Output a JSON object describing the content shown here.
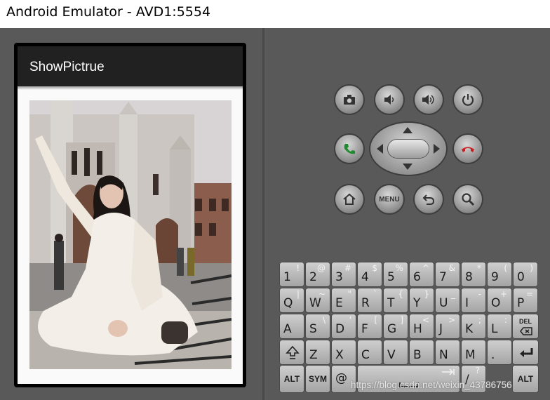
{
  "window": {
    "title": "Android Emulator - AVD1:5554"
  },
  "app": {
    "title": "ShowPictrue"
  },
  "controls": {
    "camera": "camera-icon",
    "volume_down": "volume-down-icon",
    "volume_up": "volume-up-icon",
    "power": "power-icon",
    "call": "call-icon",
    "end_call": "end-call-icon",
    "home": "home-icon",
    "menu_label": "MENU",
    "back": "back-icon",
    "search": "search-icon"
  },
  "keyboard": {
    "row1": [
      {
        "m": "1",
        "s": "!"
      },
      {
        "m": "2",
        "s": "@"
      },
      {
        "m": "3",
        "s": "#"
      },
      {
        "m": "4",
        "s": "$"
      },
      {
        "m": "5",
        "s": "%"
      },
      {
        "m": "6",
        "s": "^"
      },
      {
        "m": "7",
        "s": "&"
      },
      {
        "m": "8",
        "s": "*"
      },
      {
        "m": "9",
        "s": "("
      },
      {
        "m": "0",
        "s": ")"
      }
    ],
    "row2": [
      {
        "m": "Q",
        "s": "|"
      },
      {
        "m": "W",
        "s": "~"
      },
      {
        "m": "E",
        "s": "\""
      },
      {
        "m": "R",
        "s": "`"
      },
      {
        "m": "T",
        "s": "{"
      },
      {
        "m": "Y",
        "s": "}"
      },
      {
        "m": "U",
        "s": "_"
      },
      {
        "m": "I",
        "s": "-"
      },
      {
        "m": "O",
        "s": "+"
      },
      {
        "m": "P",
        "s": "="
      }
    ],
    "row3": [
      {
        "m": "A",
        "s": ""
      },
      {
        "m": "S",
        "s": "\\"
      },
      {
        "m": "D",
        "s": "'"
      },
      {
        "m": "F",
        "s": "["
      },
      {
        "m": "G",
        "s": "]"
      },
      {
        "m": "H",
        "s": "<"
      },
      {
        "m": "J",
        "s": ">"
      },
      {
        "m": "K",
        "s": ";"
      },
      {
        "m": "L",
        "s": ":"
      }
    ],
    "del_label": "DEL",
    "row4": [
      {
        "m": "Z",
        "s": ""
      },
      {
        "m": "X",
        "s": ""
      },
      {
        "m": "C",
        "s": ""
      },
      {
        "m": "V",
        "s": ""
      },
      {
        "m": "B",
        "s": ""
      },
      {
        "m": "N",
        "s": ""
      },
      {
        "m": "M",
        "s": ""
      },
      {
        "m": ".",
        "s": ""
      }
    ],
    "alt_label": "ALT",
    "sym_label": "SYM",
    "at_label": "@",
    "slash_label": "/",
    "question_label": "?"
  },
  "watermark": "https://blog.csdn.net/weixin_43786756"
}
